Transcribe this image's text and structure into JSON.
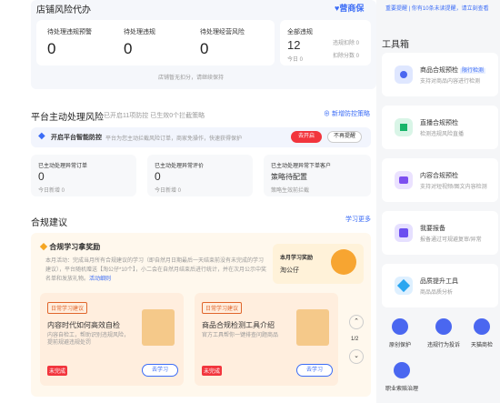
{
  "store": {
    "title": "店铺风险代办",
    "brand": "营商保",
    "stats": [
      {
        "label": "待处理违规预警",
        "value": "0"
      },
      {
        "label": "待处理违规",
        "value": "0"
      },
      {
        "label": "待处理经营风险",
        "value": "0"
      }
    ],
    "violations": {
      "label": "全部违规",
      "total": "12",
      "today": "今日 0",
      "remaining_label": "违规扣除 0",
      "score_label": "扣除分数 0"
    },
    "footer": "店铺暂无扣分，请继续保持"
  },
  "platform": {
    "title": "平台主动处理风险",
    "subtitle": "已开启11项防控 已生效0个拦截策略",
    "add_link": "新增防控策略",
    "banner_text": "开启平台智能防控",
    "banner_sub": "平台为您主动拦截风险订单，商家免操作，快速获得保护",
    "open_btn": "去开启",
    "remind_btn": "不再提醒",
    "metrics": [
      {
        "label": "已主动处理异常订单",
        "value": "0",
        "sub": "今日新增 0"
      },
      {
        "label": "已主动处理异常评价",
        "value": "0",
        "sub": "今日新增 0"
      },
      {
        "label": "已主动处理异常下单客户",
        "value": "策略待配置",
        "sub": "策略生效前拦截"
      }
    ]
  },
  "compliance": {
    "title": "合规建议",
    "more_link": "学习更多",
    "learn_title": "合规学习拿奖励",
    "learn_desc": "本月活动：完成当月所有合规建议的学习（即自然月日期最后一天结束前没有未完成的学习建议），平台随机赠送【淘公仔*10个】，小二会在自然月结束后进行统计，并在次月公示中奖名单和发放礼物。",
    "learn_link": "活动细则",
    "prize_label": "本月学习奖励",
    "prize_name": "淘公仔",
    "tips": [
      {
        "badge": "日常学习建议",
        "title": "内容时代如何高效自检",
        "desc": "内容自检工，帮助识别违规风险，提前规避违规处罚",
        "status": "未完成",
        "btn": "去学习"
      },
      {
        "badge": "日常学习建议",
        "title": "商品合规检测工具介绍",
        "desc": "官方工具帮你一键排查问题商品",
        "status": "未完成",
        "btn": "去学习"
      }
    ],
    "pager": "1/2"
  },
  "notice": "重要提醒 | 你有10条未读提醒，请立刻查看",
  "toolbox": {
    "title": "工具箱",
    "items": [
      {
        "name": "商品合规预检",
        "tag": "限行检测",
        "desc": "支持对商品内容进行检测",
        "icon": "search-icon",
        "color": "#4a67f0"
      },
      {
        "name": "直播合规预检",
        "desc": "检测违规风险直播",
        "icon": "code-icon",
        "color": "#19b56a"
      },
      {
        "name": "内容合规预检",
        "desc": "支持对短视频/图文内容检测",
        "icon": "video-icon",
        "color": "#7d4ef0"
      },
      {
        "name": "我要报备",
        "desc": "报备通过可规避复审/异常",
        "icon": "report-icon",
        "color": "#6b4ef0"
      },
      {
        "name": "品质提升工具",
        "desc": "商品品质分析",
        "icon": "diamond-icon",
        "color": "#2aa6f0"
      }
    ],
    "quick": [
      {
        "label": "原创保护",
        "icon": "shield-icon"
      },
      {
        "label": "违规行为投诉",
        "icon": "alert-icon"
      },
      {
        "label": "天猫商检",
        "icon": "cart-icon"
      },
      {
        "label": "职业索赔治理",
        "icon": "warning-icon"
      }
    ]
  }
}
